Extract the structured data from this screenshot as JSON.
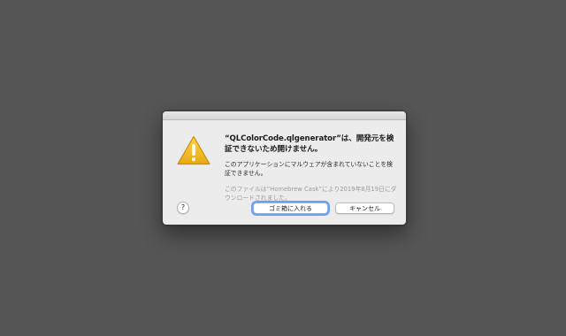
{
  "dialog": {
    "icon": "warning-triangle-icon",
    "headline": "“QLColorCode.qlgenerator”は、開発元を検証できないため開けません。",
    "body": "このアプリケーションにマルウェアが含まれていないことを検証できません。",
    "note": "このファイルは“Homebrew Cask”により2019年8月19日にダウンロードされました。",
    "help_label": "?",
    "primary_button": "ゴミ箱に入れる",
    "cancel_button": "キャンセル"
  },
  "colors": {
    "backdrop": "#565656",
    "dialog_bg": "#ececec",
    "warning_yellow": "#f5c330",
    "focus_ring": "#6fa0ee"
  }
}
